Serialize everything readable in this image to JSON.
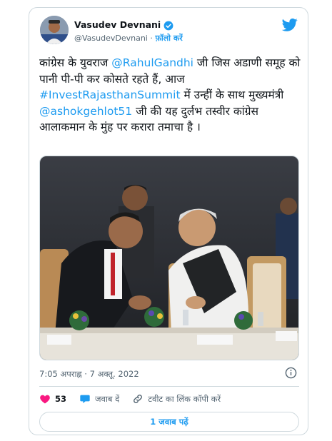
{
  "author": {
    "name": "Vasudev Devnani",
    "handle": "@VasudevDevnani",
    "separator": "·",
    "follow_label": "फ़ॉलो करें"
  },
  "tweet": {
    "text_1": "कांग्रेस के युवराज ",
    "mention_1": "@RahulGandhi",
    "text_2": " जी जिस अडाणी समूह को पानी पी-पी कर कोसते रहते हैं, आज ",
    "hashtag": "#InvestRajasthanSummit",
    "text_3": " में उन्हीं के साथ मुख्यमंत्री ",
    "mention_2": "@ashokgehlot51",
    "text_4": " जी की यह दुर्लभ तस्वीर कांग्रेस आलाकमान के मुंह पर करारा तमाचा है ।"
  },
  "timestamp": "7:05 अपराह्न · 7 अक्तू. 2022",
  "actions": {
    "like_count": "53",
    "reply_label": "जवाब दें",
    "copy_link_label": "टवीट का लिंक कॉपी करें"
  },
  "read_replies_label": "1 जवाब पढ़ें",
  "colors": {
    "accent": "#1d9bf0",
    "like": "#f91880",
    "text": "#0f1419",
    "muted": "#536471",
    "border": "#cfd9de"
  },
  "icons": [
    "verified-badge-icon",
    "twitter-bird-icon",
    "info-icon",
    "heart-icon",
    "reply-bubble-icon",
    "link-icon"
  ]
}
